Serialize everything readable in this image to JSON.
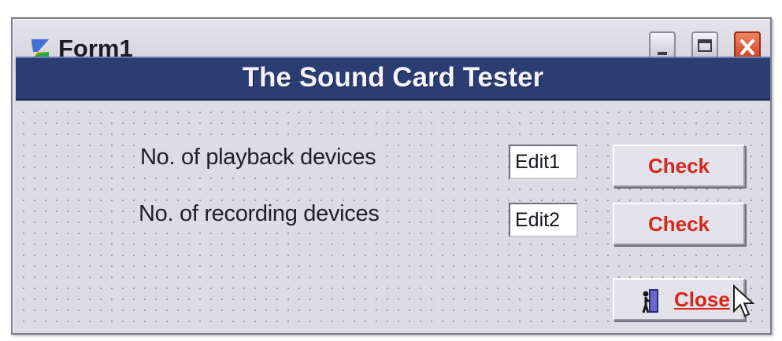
{
  "window": {
    "title": "Form1",
    "icon": "app-icon",
    "controls": [
      "minimize-icon",
      "maximize-icon",
      "close-icon"
    ]
  },
  "banner": {
    "text": "The Sound Card Tester"
  },
  "rows": [
    {
      "label": "No. of playback devices",
      "edit_value": "Edit1",
      "button_label": "Check"
    },
    {
      "label": "No. of recording devices",
      "edit_value": "Edit2",
      "button_label": "Check"
    }
  ],
  "close_button": {
    "label": "Close",
    "icon": "door-exit-icon"
  },
  "colors": {
    "banner_bg": "#2b3e74",
    "button_text": "#d8271a",
    "form_bg": "#dddce5"
  }
}
